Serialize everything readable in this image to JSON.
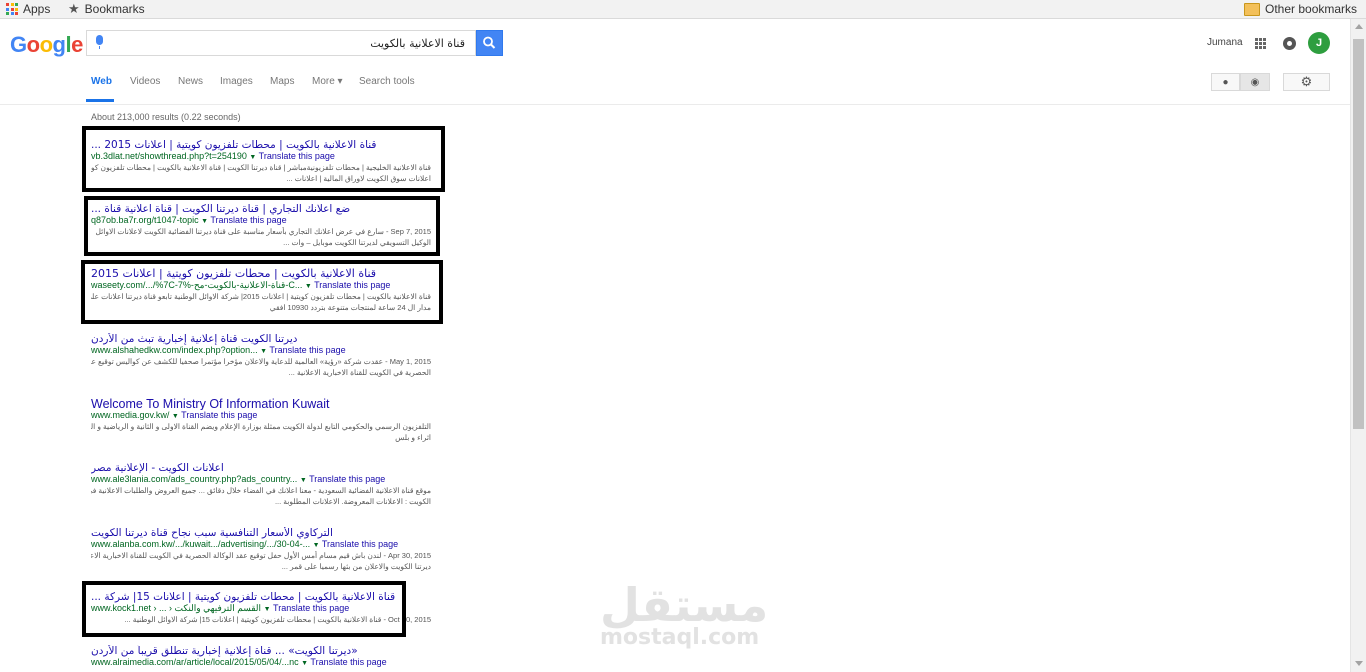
{
  "bookmarks_bar": {
    "apps_label": "Apps",
    "bookmarks_label": "Bookmarks",
    "other_label": "Other bookmarks"
  },
  "header": {
    "logo": [
      "G",
      "o",
      "o",
      "g",
      "l",
      "e"
    ],
    "logo_colors": [
      "#4285f4",
      "#ea4335",
      "#fbbc05",
      "#4285f4",
      "#34a853",
      "#ea4335"
    ],
    "query": "قناة الاعلانية بالكويت",
    "user_name": "Jumana",
    "avatar_letter": "J",
    "accent": "#4285f4"
  },
  "tabs": [
    "Web",
    "Videos",
    "News",
    "Images",
    "Maps",
    "More ▾",
    "Search tools"
  ],
  "stats": "About 213,000 results (0.22 seconds)",
  "results": [
    {
      "title": "قناة الاعلانية بالكويت | محطات تلفزيون كويتية | اعلانات 2015 ...",
      "url": "vb.3dlat.net/showthread.php?t=254190",
      "translate": "Translate this page",
      "snippet": [
        "قناة الاعلانية الخليجية | محطات تلفزيونيةمباشر | قناة ديرتنا الكويت | قناة الاعلانية بالكويت | محطات تلفزيون كويتية |",
        "اعلانات سوق الكويت لاوراق المالية | اعلانات ..."
      ]
    },
    {
      "title": "ضع اعلانك التجاري | قناة ديرتنا الكويت | قناة اعلانية قناة ...",
      "url": "q87ob.ba7r.org/t1047-topic",
      "translate": "Translate this page",
      "snippet": [
        "Sep 7, 2015 - سارع في عرض اعلانك التجاري بأسعار مناسبة على قناة ديرتنا الفضائية الكويت لاعلانات الاوائل",
        "الوكيل التسويقي لديرتنا الكويت موبايل – وات ..."
      ]
    },
    {
      "title": "قناة الاعلانية بالكويت | محطات تلفزيون كويتية | اعلانات 2015",
      "url": "waseety.com/.../%7C-7%-قناة-الاعلانية-بالكويت-مح-C...",
      "translate": "Translate this page",
      "snippet": [
        "قناة الاعلانية بالكويت | محطات تلفزيون كويتية | اعلانات 2015| شركة الاوائل الوطنية تابعو قناة ديرتنا اعلانات على",
        "مدار ال 24 ساعة لمنتجات متنوعة بتردد 10930 افقي"
      ]
    },
    {
      "title": "ديرتنا الكويت قناة إعلانية إخبارية تبث من الأردن",
      "url": "www.alshahedkw.com/index.php?option...",
      "translate": "Translate this page",
      "snippet": [
        "May 1, 2015 - عقدت شركة «رؤية» العالمية للدعاية والاعلان مؤخرا مؤتمرا صحفيا للكشف عن كواليس توقيع عقد الوكالة",
        "الحصرية في الكويت للقناة الاخبارية الاعلانية ..."
      ]
    },
    {
      "title": "Welcome To Ministry Of Information Kuwait",
      "url": "www.media.gov.kw/",
      "translate": "Translate this page",
      "snippet": [
        "التلفزيون الرسمي والحكومي التابع لدولة الكويت ممثلة بوزارة الإعلام ويضم القناة الاولى و الثانية و الرياضية و العربي و",
        "اثراء و بلس"
      ]
    },
    {
      "title": "اعلانات الكويت - الإعلانية مصر",
      "url": "www.ale3lania.com/ads_country.php?ads_country...",
      "translate": "Translate this page",
      "snippet": [
        "موقع قناة الاعلانية الفضائية السعودية - معنا اعلانك في الفضاء خلال دقائق ... جميع العروض والطلبات الاعلانية في",
        "الكويت : الاعلانات المعروضة. الاعلانات المطلوبة ..."
      ]
    },
    {
      "title": "التركاوي الأسعار التنافسية سبب نجاح قناة ديرتنا الكويت",
      "url": "www.alanba.com.kw/.../kuwait.../advertising/.../30-04-...",
      "translate": "Translate this page",
      "snippet": [
        "Apr 30, 2015 - لندن باش قيم مسام أمس الأول حفل توقيع عقد الوكالة الحصرية في الكويت للقناة الاخبارية الاعلانية",
        "ديرتنا الكويت والاعلان من بثها رسميا على قمر ..."
      ]
    },
    {
      "title": "قناة الاعلانية بالكويت | محطات تلفزيون كويتية | اعلانات 15| شركة ...",
      "url": "www.kock1.net › ... › القسم الترفيهي والنكت",
      "translate": "Translate this page",
      "snippet": [
        "Oct 20, 2015 - قناة الاعلانية بالكويت | محطات تلفزيون كويتية | اعلانات 15| شركة الاوائل الوطنية ..."
      ]
    },
    {
      "title": "«ديرتنا الكويت» ... قناة إعلانية إخبارية تنطلق قريباً من الأردن",
      "url": "www.alraimedia.com/ar/article/local/2015/05/04/...nc",
      "translate": "Translate this page",
      "snippet": []
    }
  ],
  "watermark": {
    "arabic": "مستقل",
    "latin": "mostaql.com"
  }
}
